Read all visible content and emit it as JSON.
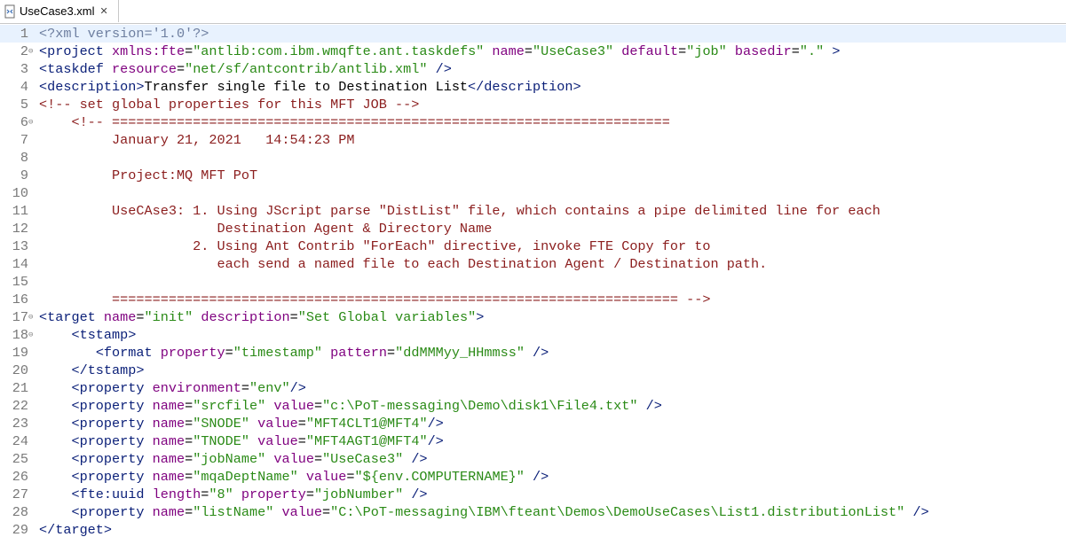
{
  "tab": {
    "title": "UseCase3.xml",
    "close_glyph": "✕"
  },
  "line_numbers": [
    "1",
    "2",
    "3",
    "4",
    "5",
    "6",
    "7",
    "8",
    "9",
    "10",
    "11",
    "12",
    "13",
    "14",
    "15",
    "16",
    "17",
    "18",
    "19",
    "20",
    "21",
    "22",
    "23",
    "24",
    "25",
    "26",
    "27",
    "28",
    "29"
  ],
  "fold_glyph": "⊖",
  "lines": [
    [
      {
        "c": "pi",
        "t": "<?xml version='1.0'?>"
      }
    ],
    [
      {
        "c": "t",
        "t": "<project "
      },
      {
        "c": "a",
        "t": "xmlns:fte"
      },
      {
        "c": "x",
        "t": "="
      },
      {
        "c": "v",
        "t": "\"antlib:com.ibm.wmqfte.ant.taskdefs\""
      },
      {
        "c": "x",
        "t": " "
      },
      {
        "c": "a",
        "t": "name"
      },
      {
        "c": "x",
        "t": "="
      },
      {
        "c": "v",
        "t": "\"UseCase3\""
      },
      {
        "c": "x",
        "t": " "
      },
      {
        "c": "a",
        "t": "default"
      },
      {
        "c": "x",
        "t": "="
      },
      {
        "c": "v",
        "t": "\"job\""
      },
      {
        "c": "x",
        "t": " "
      },
      {
        "c": "a",
        "t": "basedir"
      },
      {
        "c": "x",
        "t": "="
      },
      {
        "c": "v",
        "t": "\".\""
      },
      {
        "c": "t",
        "t": " >"
      }
    ],
    [
      {
        "c": "t",
        "t": "<taskdef "
      },
      {
        "c": "a",
        "t": "resource"
      },
      {
        "c": "x",
        "t": "="
      },
      {
        "c": "v",
        "t": "\"net/sf/antcontrib/antlib.xml\""
      },
      {
        "c": "t",
        "t": " />"
      }
    ],
    [
      {
        "c": "t",
        "t": "<description>"
      },
      {
        "c": "x",
        "t": "Transfer single file to Destination List"
      },
      {
        "c": "t",
        "t": "</description>"
      }
    ],
    [
      {
        "c": "c",
        "t": "<!-- set global properties for this MFT JOB -->"
      }
    ],
    [
      {
        "c": "c",
        "t": "    <!-- ====================================================================="
      }
    ],
    [
      {
        "c": "c",
        "t": "         January 21, 2021   14:54:23 PM"
      }
    ],
    [
      {
        "c": "c",
        "t": ""
      }
    ],
    [
      {
        "c": "c",
        "t": "         Project:MQ MFT PoT"
      }
    ],
    [
      {
        "c": "c",
        "t": ""
      }
    ],
    [
      {
        "c": "c",
        "t": "         UseCAse3: 1. Using JScript parse \"DistList\" file, which contains a pipe delimited line for each"
      }
    ],
    [
      {
        "c": "c",
        "t": "                      Destination Agent & Directory Name"
      }
    ],
    [
      {
        "c": "c",
        "t": "                   2. Using Ant Contrib \"ForEach\" directive, invoke FTE Copy for to"
      }
    ],
    [
      {
        "c": "c",
        "t": "                      each send a named file to each Destination Agent / Destination path."
      }
    ],
    [
      {
        "c": "c",
        "t": ""
      }
    ],
    [
      {
        "c": "c",
        "t": "         ====================================================================== -->"
      }
    ],
    [
      {
        "c": "t",
        "t": "<target "
      },
      {
        "c": "a",
        "t": "name"
      },
      {
        "c": "x",
        "t": "="
      },
      {
        "c": "v",
        "t": "\"init\""
      },
      {
        "c": "x",
        "t": " "
      },
      {
        "c": "a",
        "t": "description"
      },
      {
        "c": "x",
        "t": "="
      },
      {
        "c": "v",
        "t": "\"Set Global variables\""
      },
      {
        "c": "t",
        "t": ">"
      }
    ],
    [
      {
        "c": "x",
        "t": "    "
      },
      {
        "c": "t",
        "t": "<tstamp>"
      }
    ],
    [
      {
        "c": "x",
        "t": "       "
      },
      {
        "c": "t",
        "t": "<format "
      },
      {
        "c": "a",
        "t": "property"
      },
      {
        "c": "x",
        "t": "="
      },
      {
        "c": "v",
        "t": "\"timestamp\""
      },
      {
        "c": "x",
        "t": " "
      },
      {
        "c": "a",
        "t": "pattern"
      },
      {
        "c": "x",
        "t": "="
      },
      {
        "c": "v",
        "t": "\"ddMMMyy_HHmmss\""
      },
      {
        "c": "t",
        "t": " />"
      }
    ],
    [
      {
        "c": "x",
        "t": "    "
      },
      {
        "c": "t",
        "t": "</tstamp>"
      }
    ],
    [
      {
        "c": "x",
        "t": "    "
      },
      {
        "c": "t",
        "t": "<property "
      },
      {
        "c": "a",
        "t": "environment"
      },
      {
        "c": "x",
        "t": "="
      },
      {
        "c": "v",
        "t": "\"env\""
      },
      {
        "c": "t",
        "t": "/>"
      }
    ],
    [
      {
        "c": "x",
        "t": "    "
      },
      {
        "c": "t",
        "t": "<property "
      },
      {
        "c": "a",
        "t": "name"
      },
      {
        "c": "x",
        "t": "="
      },
      {
        "c": "v",
        "t": "\"srcfile\""
      },
      {
        "c": "x",
        "t": " "
      },
      {
        "c": "a",
        "t": "value"
      },
      {
        "c": "x",
        "t": "="
      },
      {
        "c": "v",
        "t": "\"c:\\PoT-messaging\\Demo\\disk1\\File4.txt\""
      },
      {
        "c": "t",
        "t": " />"
      }
    ],
    [
      {
        "c": "x",
        "t": "    "
      },
      {
        "c": "t",
        "t": "<property "
      },
      {
        "c": "a",
        "t": "name"
      },
      {
        "c": "x",
        "t": "="
      },
      {
        "c": "v",
        "t": "\"SNODE\""
      },
      {
        "c": "x",
        "t": " "
      },
      {
        "c": "a",
        "t": "value"
      },
      {
        "c": "x",
        "t": "="
      },
      {
        "c": "v",
        "t": "\"MFT4CLT1@MFT4\""
      },
      {
        "c": "t",
        "t": "/>"
      }
    ],
    [
      {
        "c": "x",
        "t": "    "
      },
      {
        "c": "t",
        "t": "<property "
      },
      {
        "c": "a",
        "t": "name"
      },
      {
        "c": "x",
        "t": "="
      },
      {
        "c": "v",
        "t": "\"TNODE\""
      },
      {
        "c": "x",
        "t": " "
      },
      {
        "c": "a",
        "t": "value"
      },
      {
        "c": "x",
        "t": "="
      },
      {
        "c": "v",
        "t": "\"MFT4AGT1@MFT4\""
      },
      {
        "c": "t",
        "t": "/>"
      }
    ],
    [
      {
        "c": "x",
        "t": "    "
      },
      {
        "c": "t",
        "t": "<property "
      },
      {
        "c": "a",
        "t": "name"
      },
      {
        "c": "x",
        "t": "="
      },
      {
        "c": "v",
        "t": "\"jobName\""
      },
      {
        "c": "x",
        "t": " "
      },
      {
        "c": "a",
        "t": "value"
      },
      {
        "c": "x",
        "t": "="
      },
      {
        "c": "v",
        "t": "\"UseCase3\""
      },
      {
        "c": "t",
        "t": " />"
      }
    ],
    [
      {
        "c": "x",
        "t": "    "
      },
      {
        "c": "t",
        "t": "<property "
      },
      {
        "c": "a",
        "t": "name"
      },
      {
        "c": "x",
        "t": "="
      },
      {
        "c": "v",
        "t": "\"mqaDeptName\""
      },
      {
        "c": "x",
        "t": " "
      },
      {
        "c": "a",
        "t": "value"
      },
      {
        "c": "x",
        "t": "="
      },
      {
        "c": "v",
        "t": "\"${env.COMPUTERNAME}\""
      },
      {
        "c": "t",
        "t": " />"
      }
    ],
    [
      {
        "c": "x",
        "t": "    "
      },
      {
        "c": "t",
        "t": "<fte:uuid "
      },
      {
        "c": "a",
        "t": "length"
      },
      {
        "c": "x",
        "t": "="
      },
      {
        "c": "v",
        "t": "\"8\""
      },
      {
        "c": "x",
        "t": " "
      },
      {
        "c": "a",
        "t": "property"
      },
      {
        "c": "x",
        "t": "="
      },
      {
        "c": "v",
        "t": "\"jobNumber\""
      },
      {
        "c": "t",
        "t": " />"
      }
    ],
    [
      {
        "c": "x",
        "t": "    "
      },
      {
        "c": "t",
        "t": "<property "
      },
      {
        "c": "a",
        "t": "name"
      },
      {
        "c": "x",
        "t": "="
      },
      {
        "c": "v",
        "t": "\"listName\""
      },
      {
        "c": "x",
        "t": " "
      },
      {
        "c": "a",
        "t": "value"
      },
      {
        "c": "x",
        "t": "="
      },
      {
        "c": "v",
        "t": "\"C:\\PoT-messaging\\IBM\\fteant\\Demos\\DemoUseCases\\List1.distributionList\""
      },
      {
        "c": "t",
        "t": " />"
      }
    ],
    [
      {
        "c": "t",
        "t": "</target>"
      }
    ]
  ]
}
